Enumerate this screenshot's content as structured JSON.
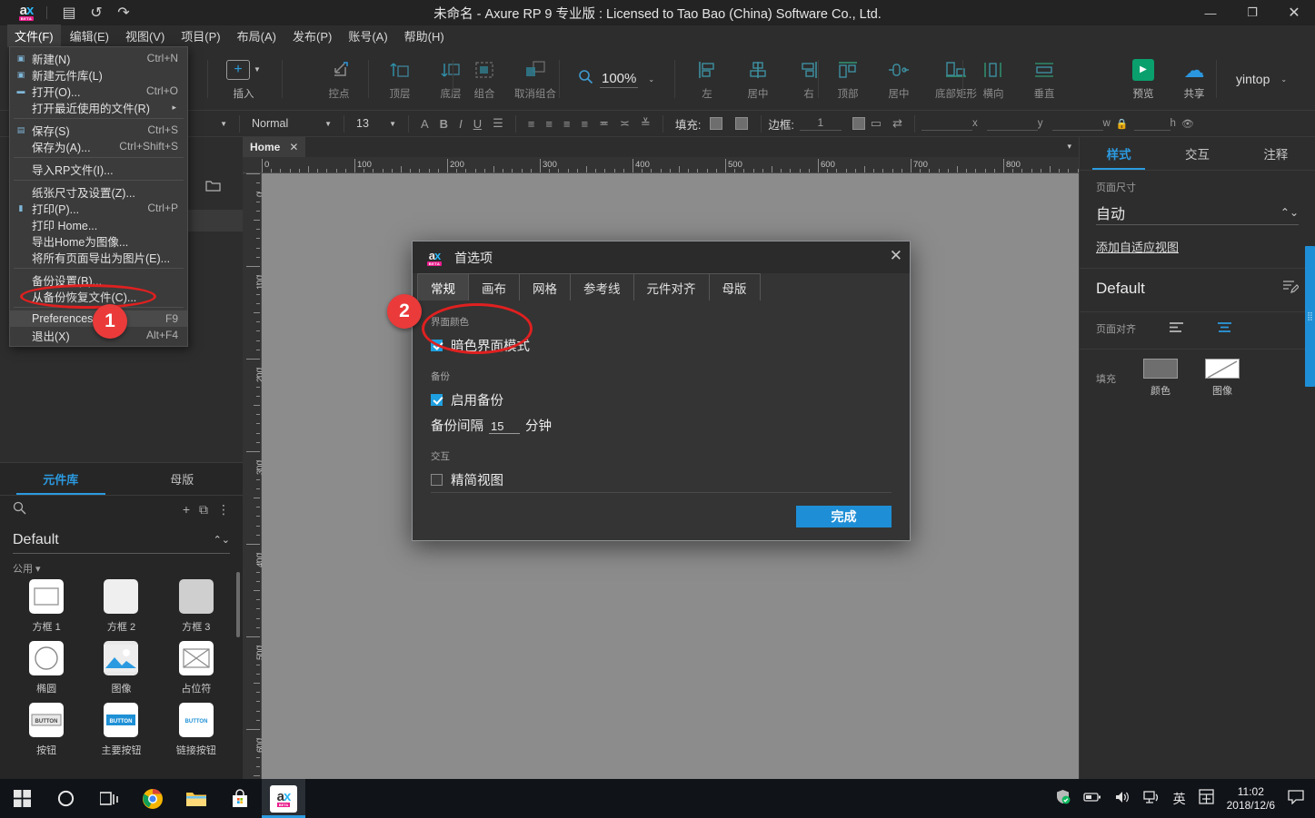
{
  "window": {
    "title": "未命名 - Axure RP 9 专业版 : Licensed to Tao Bao (China) Software Co., Ltd.",
    "minimize": "—",
    "maximize": "❐",
    "close": "✕",
    "logo_text": "ax",
    "logo_badge": "BETA"
  },
  "quick_access": [
    {
      "name": "save-icon",
      "glyph": "▤"
    },
    {
      "name": "undo-icon",
      "glyph": "↺"
    },
    {
      "name": "redo-icon",
      "glyph": "↷"
    }
  ],
  "menubar": {
    "items": [
      {
        "label": "文件(F)",
        "open": true
      },
      {
        "label": "编辑(E)",
        "open": false
      },
      {
        "label": "视图(V)",
        "open": false
      },
      {
        "label": "项目(P)",
        "open": false
      },
      {
        "label": "布局(A)",
        "open": false
      },
      {
        "label": "发布(P)",
        "open": false
      },
      {
        "label": "账号(A)",
        "open": false
      },
      {
        "label": "帮助(H)",
        "open": false
      }
    ]
  },
  "file_menu": {
    "items": [
      {
        "label": "新建(N)",
        "shortcut": "Ctrl+N",
        "icon": "page-icon",
        "sep_after": false
      },
      {
        "label": "新建元件库(L)",
        "shortcut": "",
        "icon": "library-icon",
        "sep_after": false
      },
      {
        "label": "打开(O)...",
        "shortcut": "Ctrl+O",
        "icon": "folder-open-icon",
        "sep_after": false
      },
      {
        "label": "打开最近使用的文件(R)",
        "shortcut": "",
        "icon": "",
        "submenu": "▸",
        "sep_after": true
      },
      {
        "label": "保存(S)",
        "shortcut": "Ctrl+S",
        "icon": "save-icon",
        "sep_after": false
      },
      {
        "label": "保存为(A)...",
        "shortcut": "Ctrl+Shift+S",
        "icon": "",
        "sep_after": true
      },
      {
        "label": "导入RP文件(I)...",
        "shortcut": "",
        "icon": "",
        "sep_after": true
      },
      {
        "label": "纸张尺寸及设置(Z)...",
        "shortcut": "",
        "icon": "",
        "sep_after": false
      },
      {
        "label": "打印(P)...",
        "shortcut": "Ctrl+P",
        "icon": "print-icon",
        "sep_after": false
      },
      {
        "label": "打印 Home...",
        "shortcut": "",
        "icon": "",
        "sep_after": false
      },
      {
        "label": "导出Home为图像...",
        "shortcut": "",
        "icon": "",
        "sep_after": false
      },
      {
        "label": "将所有页面导出为图片(E)...",
        "shortcut": "",
        "icon": "",
        "sep_after": true
      },
      {
        "label": "备份设置(B)...",
        "shortcut": "",
        "icon": "",
        "sep_after": false
      },
      {
        "label": "从备份恢复文件(C)...",
        "shortcut": "",
        "icon": "",
        "sep_after": true
      },
      {
        "label": "Preferences",
        "shortcut": "F9",
        "icon": "",
        "highlight": true,
        "sep_after": false
      },
      {
        "label": "退出(X)",
        "shortcut": "Alt+F4",
        "icon": "",
        "sep_after": false
      }
    ]
  },
  "toolbar": {
    "insert": {
      "label": "插入",
      "glyph": "+"
    },
    "groups": [
      {
        "tools": [
          {
            "label": "控点",
            "name": "handle-tool",
            "glyph": "↗"
          }
        ]
      },
      {
        "tools": [
          {
            "label": "顶层",
            "name": "bring-to-front-tool",
            "glyph": "⬆"
          },
          {
            "label": "底层",
            "name": "send-to-back-tool",
            "glyph": "⬇"
          }
        ]
      },
      {
        "tools": [
          {
            "label": "组合",
            "name": "group-tool",
            "glyph": "◫"
          },
          {
            "label": "取消组合",
            "name": "ungroup-tool",
            "glyph": "◨"
          }
        ]
      }
    ],
    "zoom": {
      "value": "100%",
      "icon": "magnifier-icon",
      "caret": "⌄"
    },
    "align_h": [
      {
        "label": "左",
        "name": "align-left-tool"
      },
      {
        "label": "居中",
        "name": "align-center-tool"
      },
      {
        "label": "右",
        "name": "align-right-tool"
      }
    ],
    "align_v": [
      {
        "label": "顶部",
        "name": "align-top-tool"
      },
      {
        "label": "居中",
        "name": "align-middle-tool"
      },
      {
        "label": "底部矩形",
        "name": "align-bottom-tool"
      }
    ],
    "distribute": [
      {
        "label": "横向",
        "name": "distribute-horizontal-tool"
      },
      {
        "label": "垂直",
        "name": "distribute-vertical-tool"
      }
    ],
    "preview": {
      "label": "预览",
      "glyph": "▶"
    },
    "share": {
      "label": "共享",
      "glyph": "☁"
    },
    "account": {
      "name": "yintop",
      "caret": "⌄"
    }
  },
  "formatbar": {
    "font_family": "",
    "font_style": "Normal",
    "font_size": "13",
    "text_tools": [
      {
        "name": "font-color-icon",
        "glyph": "A"
      },
      {
        "name": "bold-icon",
        "glyph": "B"
      },
      {
        "name": "italic-icon",
        "glyph": "I"
      },
      {
        "name": "underline-icon",
        "glyph": "U"
      },
      {
        "name": "bullet-list-icon",
        "glyph": "☰"
      }
    ],
    "align_tools": [
      {
        "name": "text-align-left-icon",
        "glyph": "≡"
      },
      {
        "name": "text-align-center-icon",
        "glyph": "≡"
      },
      {
        "name": "text-align-right-icon",
        "glyph": "≡"
      },
      {
        "name": "text-align-justify-icon",
        "glyph": "≡"
      },
      {
        "name": "valign-top-icon",
        "glyph": "≖"
      },
      {
        "name": "valign-middle-icon",
        "glyph": "≍"
      },
      {
        "name": "valign-bottom-icon",
        "glyph": "≚"
      }
    ],
    "fill_label": "填充:",
    "border_label": "边框:",
    "border_width": "1",
    "coords": {
      "x": "x",
      "y": "y",
      "w": "w",
      "h": "h"
    }
  },
  "pages_panel": {
    "add_icon": "⊞",
    "folder_icon": "🗀"
  },
  "library_panel": {
    "tabs": [
      {
        "label": "元件库",
        "active": true
      },
      {
        "label": "母版",
        "active": false
      }
    ],
    "search_icon": "search-icon",
    "add_icon": "+",
    "copy_icon": "⧉",
    "more_icon": "⋮",
    "selected_library": "Default",
    "group_label": "公用",
    "group_caret": "▾",
    "widgets": [
      {
        "label": "方框 1",
        "name": "widget-box-1"
      },
      {
        "label": "方框 2",
        "name": "widget-box-2"
      },
      {
        "label": "方框 3",
        "name": "widget-box-3"
      },
      {
        "label": "椭圆",
        "name": "widget-ellipse"
      },
      {
        "label": "图像",
        "name": "widget-image"
      },
      {
        "label": "占位符",
        "name": "widget-placeholder"
      },
      {
        "label": "按钮",
        "name": "widget-button"
      },
      {
        "label": "主要按钮",
        "name": "widget-primary-button"
      },
      {
        "label": "链接按钮",
        "name": "widget-link-button"
      }
    ]
  },
  "canvas": {
    "tab_label": "Home",
    "tab_close": "✕",
    "tab_caret": "▾",
    "ruler_h_ticks": [
      "0",
      "100",
      "200",
      "300",
      "400",
      "500",
      "600",
      "700",
      "800"
    ],
    "ruler_v_ticks": [
      "0",
      "100",
      "200",
      "300",
      "400",
      "500",
      "600"
    ]
  },
  "right_panel": {
    "tabs": [
      {
        "label": "样式",
        "active": true
      },
      {
        "label": "交互",
        "active": false
      },
      {
        "label": "注释",
        "active": false
      }
    ],
    "page_size_label": "页面尺寸",
    "page_size_value": "自动",
    "adaptive_link": "添加自适应视图",
    "style_name": "Default",
    "style_edit_icon": "edit-style-icon",
    "page_align_label": "页面对齐",
    "fill_label": "填充",
    "fill_color_label": "颜色",
    "fill_image_label": "图像"
  },
  "preferences_dialog": {
    "title": "首选项",
    "logo_text": "ax",
    "logo_badge": "BETA",
    "close": "✕",
    "tabs": [
      {
        "label": "常规",
        "active": true
      },
      {
        "label": "画布",
        "active": false
      },
      {
        "label": "网格",
        "active": false
      },
      {
        "label": "参考线",
        "active": false
      },
      {
        "label": "元件对齐",
        "active": false
      },
      {
        "label": "母版",
        "active": false
      }
    ],
    "section_ui_color": "界面颜色",
    "dark_mode_label": "暗色界面模式",
    "dark_mode_checked": true,
    "section_backup": "备份",
    "enable_backup_label": "启用备份",
    "enable_backup_checked": true,
    "backup_interval_label": "备份间隔",
    "backup_interval_value": "15",
    "backup_interval_unit": "分钟",
    "section_interaction": "交互",
    "simple_view_label": "精简视图",
    "simple_view_checked": false,
    "done_label": "完成"
  },
  "annotations": [
    {
      "number": "1",
      "name": "annotation-badge-1"
    },
    {
      "number": "2",
      "name": "annotation-badge-2"
    }
  ],
  "taskbar": {
    "apps": [
      {
        "name": "start-button",
        "glyph": "⊞"
      },
      {
        "name": "cortana-icon",
        "glyph": "◯"
      },
      {
        "name": "task-view-icon",
        "glyph": "❏"
      },
      {
        "name": "chrome-icon",
        "glyph": ""
      },
      {
        "name": "file-explorer-icon",
        "glyph": ""
      },
      {
        "name": "microsoft-store-icon",
        "glyph": ""
      },
      {
        "name": "axure-taskbar-icon",
        "glyph": "ax"
      }
    ],
    "tray": [
      {
        "name": "security-icon",
        "glyph": "🛡"
      },
      {
        "name": "battery-icon",
        "glyph": "▭"
      },
      {
        "name": "volume-icon",
        "glyph": "◁»"
      },
      {
        "name": "network-icon",
        "glyph": "🖧"
      },
      {
        "name": "ime-icon",
        "glyph": "英"
      },
      {
        "name": "ime-panel-icon",
        "glyph": "田"
      }
    ],
    "time": "11:02",
    "date": "2018/12/6",
    "notification_icon": "▢"
  },
  "colors": {
    "accent_blue": "#2b9ae0",
    "annotation_red": "#ea3a3a",
    "canvas_gray": "#8c8c8c",
    "panel_bg": "#2d2d2d"
  }
}
